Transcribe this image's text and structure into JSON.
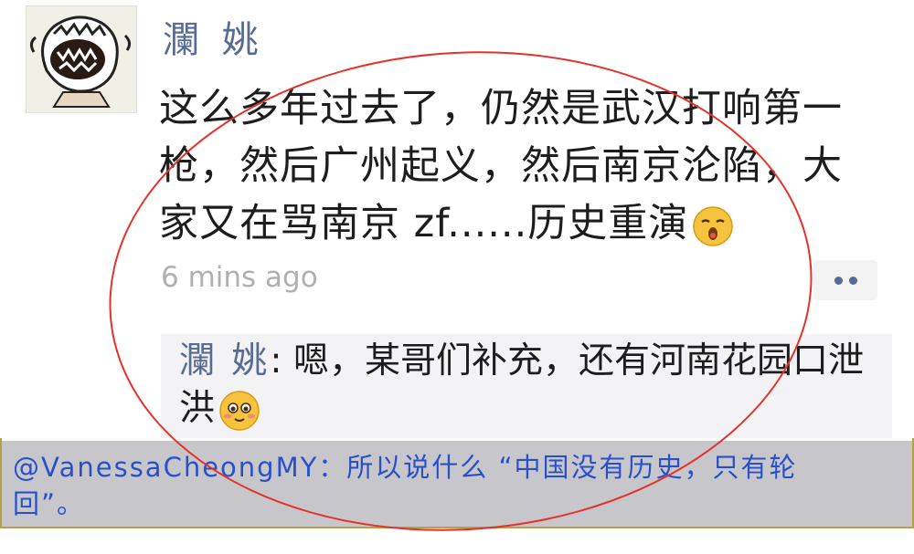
{
  "post": {
    "username": "瀾 姚",
    "comment_lines": [
      "这么多年过去了，仍然是武汉打响第一",
      "枪，然后广州起义，然后南京沦陷，大",
      "家又在骂南京 zf......历史重演"
    ],
    "timestamp": "6 mins ago",
    "reply": {
      "name": "瀾 姚",
      "separator": ": ",
      "text_line1": "嗯，某哥们补充，还有河南花园口泄",
      "text_line2": "洪"
    }
  },
  "caption": {
    "line1": "@VanessaCheongMY：所以说什么 “中国没有历史，只有轮",
    "line2": "回”。"
  },
  "icons": {
    "avatar": "cartoon-shouting-avatar",
    "comment_emoji": "sleepy-face-emoji",
    "reply_emoji": "blushing-face-emoji",
    "more": "more-dots-icon"
  },
  "colors": {
    "name_blue": "#576b95",
    "caption_blue": "#2a50c9",
    "annotation_red": "#e4322a"
  }
}
